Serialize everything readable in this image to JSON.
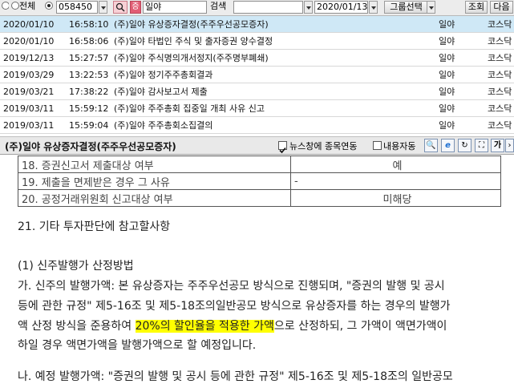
{
  "toolbar": {
    "radio_all_label": "전체",
    "stock_code": "058450",
    "stock_name": "일야",
    "search_label": "검색",
    "date": "2020/01/13",
    "group_select_label": "그룹선택",
    "lookup_button": "조회",
    "next_button": "다음"
  },
  "news": [
    {
      "date": "2020/01/10",
      "time": "16:58:10",
      "title": "(주)일야 유상증자결정(주주우선공모증자)",
      "company": "일야",
      "market": "코스닥"
    },
    {
      "date": "2020/01/10",
      "time": "16:58:06",
      "title": "(주)일야 타법인 주식 및 출자증권 양수결정",
      "company": "일야",
      "market": "코스닥"
    },
    {
      "date": "2019/12/13",
      "time": "15:27:57",
      "title": "(주)일야 주식명의개서정지(주주명부폐쇄)",
      "company": "일야",
      "market": "코스닥"
    },
    {
      "date": "2019/03/29",
      "time": "13:22:53",
      "title": "(주)일야 정기주주총회결과",
      "company": "일야",
      "market": "코스닥"
    },
    {
      "date": "2019/03/21",
      "time": "17:38:22",
      "title": "(주)일야 감사보고서 제출",
      "company": "일야",
      "market": "코스닥"
    },
    {
      "date": "2019/03/11",
      "time": "15:59:12",
      "title": "(주)일야 주주총회 집중일 개최 사유 신고",
      "company": "일야",
      "market": "코스닥"
    },
    {
      "date": "2019/03/11",
      "time": "15:59:04",
      "title": "(주)일야 주주총회소집결의",
      "company": "일야",
      "market": "코스닥"
    }
  ],
  "detail": {
    "title": "(주)일야 유상증자결정(주주우선공모증자)",
    "news_link_label": "뉴스창에 종목연동",
    "content_auto_label": "내용자동"
  },
  "doc": {
    "rows": [
      {
        "label": "18. 증권신고서 제출대상 여부",
        "value": "예"
      },
      {
        "label": "19. 제출을 면제받은 경우 그 사유",
        "value": "-"
      },
      {
        "label": "20. 공정거래위원회 신고대상 여부",
        "value": "미해당"
      }
    ],
    "section_title": "21. 기타 투자판단에 참고할사항",
    "sub_title": "(1) 신주발행가 산정방법",
    "para_a_line1": "가. 신주의 발행가액: 본 유상증자는 주주우선공모 방식으로 진행되며, \"증권의 발행 및 공시",
    "para_a_line2": "등에 관한 규정\" 제5-16조 및 제5-18조의일반공모 방식으로 유상증자를 하는 경우의 발행가",
    "para_a_line3_pre": "액 산정 방식을 준용하여 ",
    "para_a_line3_hl": "20%의 할인율을 적용한 가액",
    "para_a_line3_post": "으로 산정하되, 그 가액이 액면가액이",
    "para_a_line4": "하일 경우 액면가액을 발행가액으로 할 예정입니다.",
    "para_b_line1": "나. 예정 발행가액: \"증권의 발행 및 공시 등에 관한 규정\" 제5-16조 및 제5-18조의 일반공모"
  }
}
